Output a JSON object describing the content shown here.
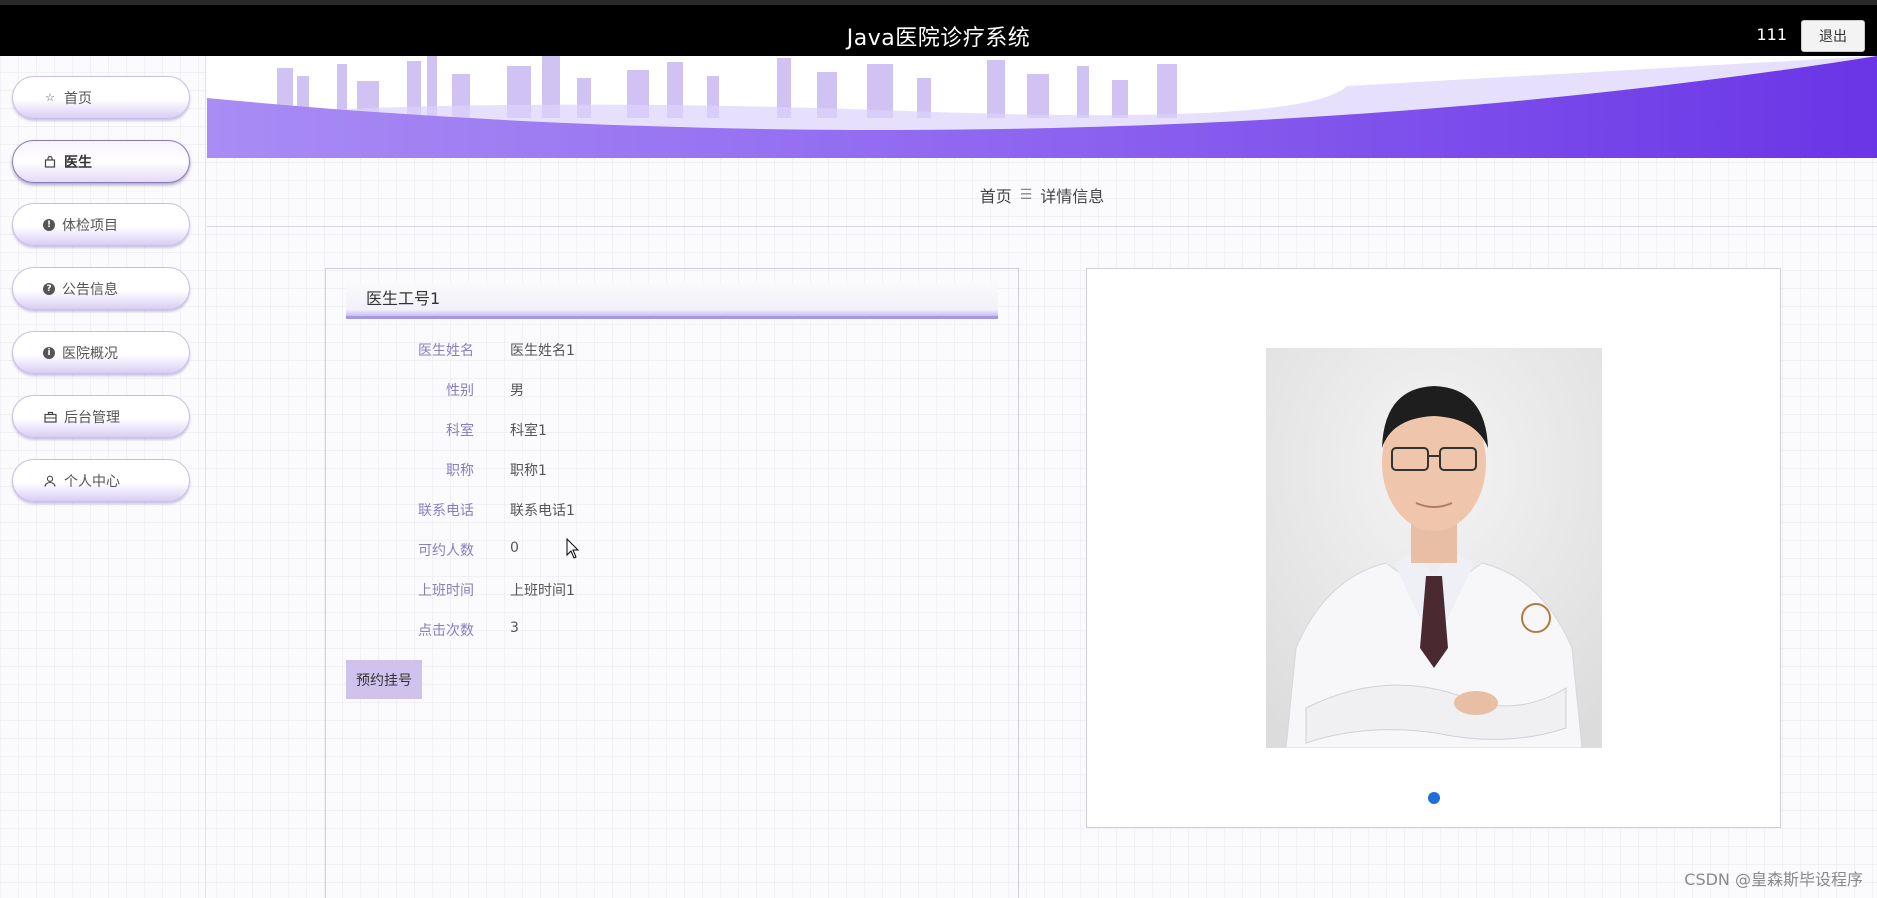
{
  "header": {
    "app_title": "Java医院诊疗系统",
    "user_name": "111",
    "logout_label": "退出"
  },
  "sidebar": {
    "items": [
      {
        "label": "首页",
        "icon": "star-icon"
      },
      {
        "label": "医生",
        "icon": "bag-icon",
        "active": true
      },
      {
        "label": "体检项目",
        "icon": "exclamation-circle-icon"
      },
      {
        "label": "公告信息",
        "icon": "question-circle-icon"
      },
      {
        "label": "医院概况",
        "icon": "info-circle-icon"
      },
      {
        "label": "后台管理",
        "icon": "briefcase-icon"
      },
      {
        "label": "个人中心",
        "icon": "user-icon"
      }
    ]
  },
  "breadcrumb": {
    "home": "首页",
    "separator": "☰",
    "current": "详情信息"
  },
  "detail": {
    "title": "医生工号1",
    "fields": [
      {
        "label": "医生姓名",
        "value": "医生姓名1"
      },
      {
        "label": "性别",
        "value": "男"
      },
      {
        "label": "科室",
        "value": "科室1"
      },
      {
        "label": "职称",
        "value": "职称1"
      },
      {
        "label": "联系电话",
        "value": "联系电话1"
      },
      {
        "label": "可约人数",
        "value": "0"
      },
      {
        "label": "上班时间",
        "value": "上班时间1"
      },
      {
        "label": "点击次数",
        "value": "3"
      }
    ],
    "book_label": "预约挂号"
  },
  "colors": {
    "accent": "#7b4fe8",
    "label": "#8a7dc0",
    "button": "#cfc3ee",
    "dot": "#1e6fd9"
  },
  "watermark": "CSDN @皇森斯毕设程序"
}
